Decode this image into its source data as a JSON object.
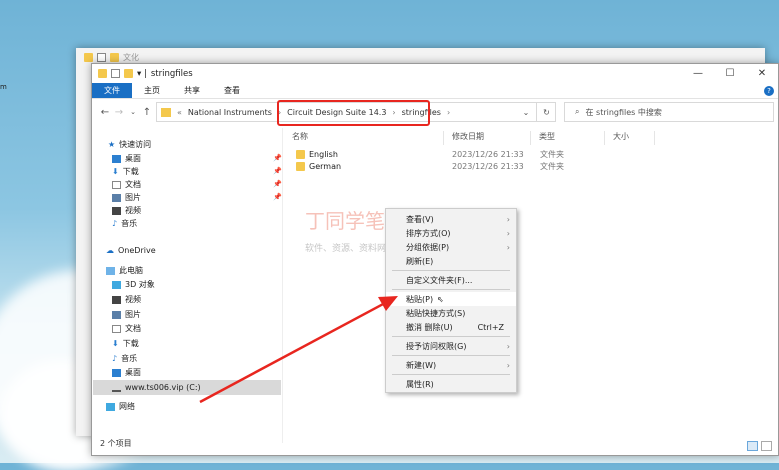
{
  "desktop": {
    "edge_text": "m"
  },
  "back_window": {
    "title": "文化"
  },
  "window": {
    "title": "stringfiles",
    "controls": [
      "minimize",
      "maximize",
      "close"
    ]
  },
  "ribbon": {
    "tabs": [
      "文件",
      "主页",
      "共享",
      "查看"
    ]
  },
  "address": {
    "segments": [
      "National Instruments",
      "Circuit Design Suite 14.3",
      "stringfiles"
    ],
    "prefix": "«"
  },
  "search": {
    "placeholder": "在 stringfiles 中搜索"
  },
  "nav": {
    "quick_access": "快速访问",
    "quick_items": [
      "桌面",
      "下载",
      "文档",
      "图片",
      "视频",
      "音乐"
    ],
    "onedrive": "OneDrive",
    "this_pc": "此电脑",
    "pc_items": [
      "3D 对象",
      "视频",
      "图片",
      "文档",
      "下载",
      "音乐",
      "桌面"
    ],
    "drive": "www.ts006.vip (C:)",
    "network": "网络"
  },
  "columns": [
    "名称",
    "修改日期",
    "类型",
    "大小"
  ],
  "files": [
    {
      "name": "English",
      "modified": "2023/12/26 21:33",
      "type": "文件夹"
    },
    {
      "name": "German",
      "modified": "2023/12/26 21:33",
      "type": "文件夹"
    }
  ],
  "status": "2 个项目",
  "context_menu": {
    "group1": [
      {
        "label": "查看(V)",
        "submenu": true
      },
      {
        "label": "排序方式(O)",
        "submenu": true
      },
      {
        "label": "分组依据(P)",
        "submenu": true
      },
      {
        "label": "刷新(E)"
      }
    ],
    "group2": [
      {
        "label": "自定义文件夹(F)..."
      }
    ],
    "group3": [
      {
        "label": "粘贴(P)",
        "highlighted": true
      },
      {
        "label": "粘贴快捷方式(S)"
      },
      {
        "label": "撤消 删除(U)",
        "shortcut": "Ctrl+Z"
      }
    ],
    "group4": [
      {
        "label": "授予访问权限(G)",
        "submenu": true
      }
    ],
    "group5": [
      {
        "label": "新建(W)",
        "submenu": true
      }
    ],
    "group6": [
      {
        "label": "属性(R)"
      }
    ]
  },
  "watermark": {
    "line1": "丁同学笔记本",
    "line2": "软件、资源、资料网盘免费下载"
  },
  "colors": {
    "accent": "#1a6fc4",
    "annotation": "#e8261f",
    "folder": "#f4c84c"
  }
}
